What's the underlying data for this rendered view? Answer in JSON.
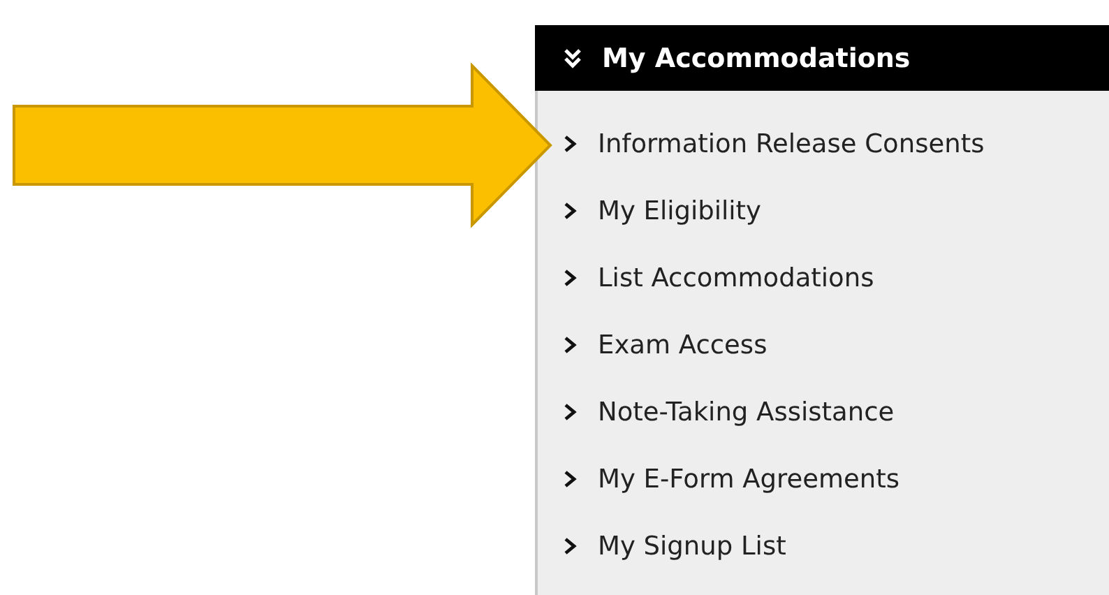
{
  "menu": {
    "title": "My Accommodations",
    "expanded": true,
    "items": [
      {
        "label": "Information Release Consents"
      },
      {
        "label": "My Eligibility"
      },
      {
        "label": "List Accommodations"
      },
      {
        "label": "Exam Access"
      },
      {
        "label": "Note-Taking Assistance"
      },
      {
        "label": "My E-Form Agreements"
      },
      {
        "label": "My Signup List"
      }
    ]
  }
}
